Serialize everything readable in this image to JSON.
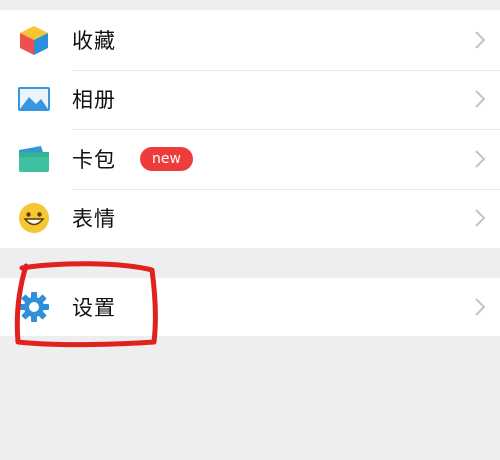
{
  "menu_primary": [
    {
      "key": "favorites",
      "label": "收藏",
      "icon": "cube-icon"
    },
    {
      "key": "album",
      "label": "相册",
      "icon": "landscape-photo-icon"
    },
    {
      "key": "wallet",
      "label": "卡包",
      "icon": "card-wallet-icon",
      "badge": "new"
    },
    {
      "key": "stickers",
      "label": "表情",
      "icon": "smiley-face-icon"
    }
  ],
  "menu_secondary": [
    {
      "key": "settings",
      "label": "设置",
      "icon": "gear-icon"
    }
  ],
  "colors": {
    "badge": "#ee3b3b",
    "gear": "#2f8fd8",
    "smiley": "#f6c633",
    "annotation": "#e0211e"
  }
}
